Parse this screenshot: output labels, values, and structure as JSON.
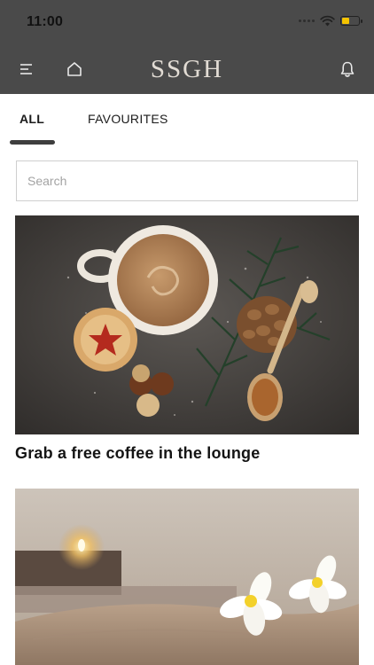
{
  "status_bar": {
    "time": "11:00"
  },
  "header": {
    "brand": "SSGH",
    "menu_icon": "menu-icon",
    "home_icon": "home-icon",
    "notification_icon": "bell-icon",
    "background": "#4a4a4a"
  },
  "tabs": [
    {
      "label": "ALL",
      "active": true
    },
    {
      "label": "FAVOURITES",
      "active": false
    }
  ],
  "search": {
    "placeholder": "Search",
    "value": ""
  },
  "feed": [
    {
      "title": "Grab a free coffee in the lounge",
      "image": "coffee-cup-with-pinecone-and-cookies"
    },
    {
      "title": "",
      "image": "spa-towel-with-frangipani-flowers-and-candle"
    }
  ]
}
